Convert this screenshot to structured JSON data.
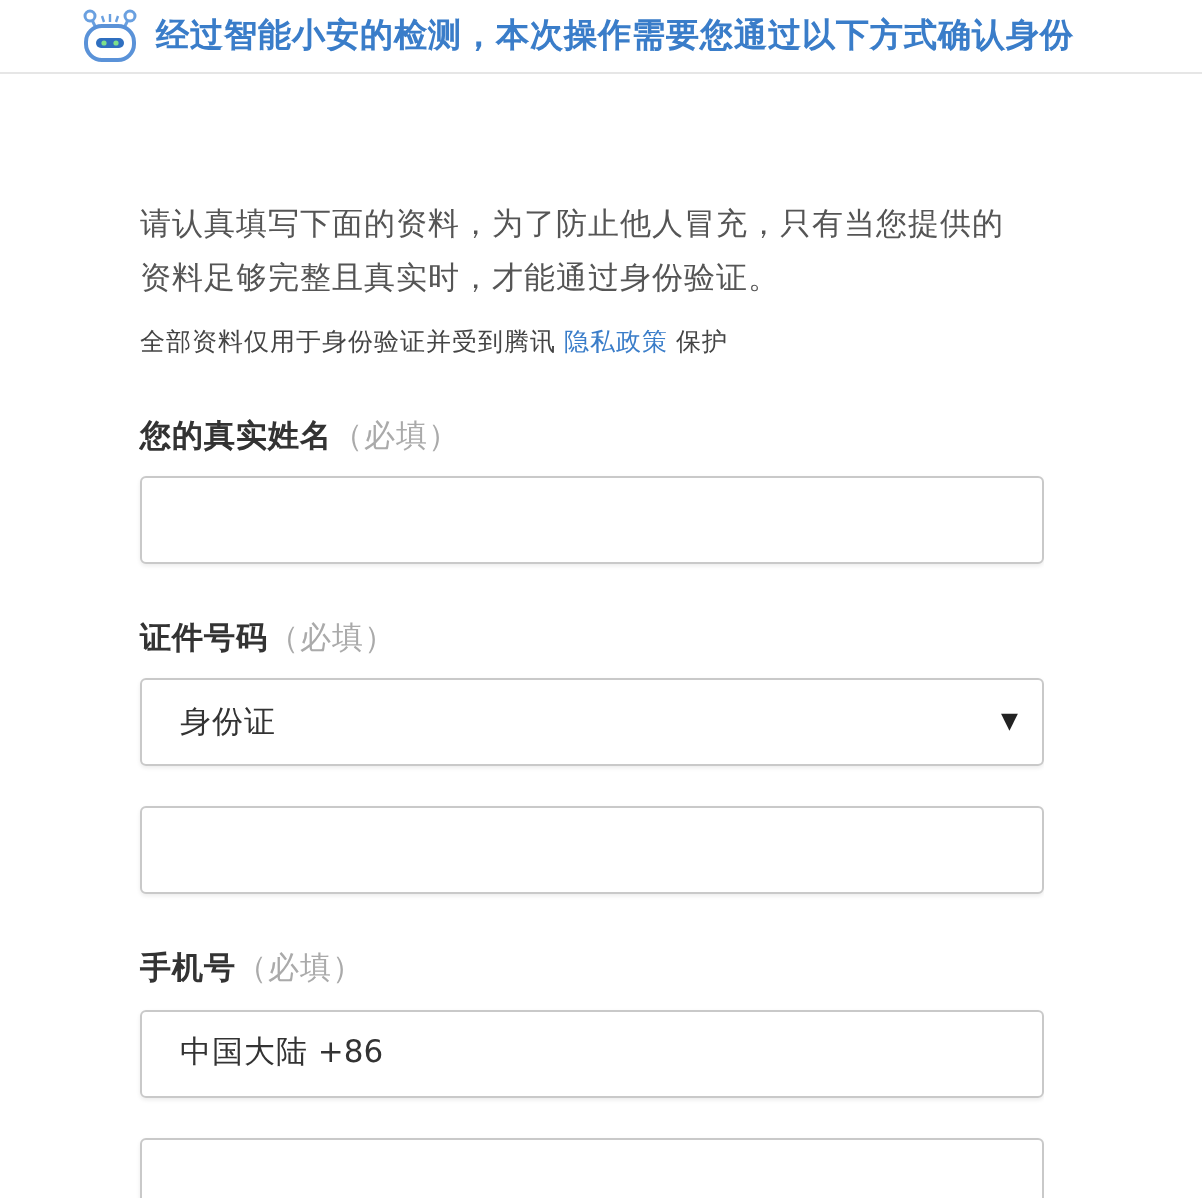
{
  "header": {
    "title": "经过智能小安的检测，本次操作需要您通过以下方式确认身份"
  },
  "intro": "请认真填写下面的资料，为了防止他人冒充，只有当您提供的资料足够完整且真实时，才能通过身份验证。",
  "note": {
    "before": "全部资料仅用于身份验证并受到腾讯",
    "link": "隐私政策",
    "after": "保护"
  },
  "sections": [
    {
      "label": "您的真实姓名",
      "hint": "（必填）",
      "fields": [
        {
          "kind": "text"
        }
      ]
    },
    {
      "label": "证件号码",
      "hint": "（必填）",
      "fields": [
        {
          "kind": "select",
          "value": "身份证",
          "arrow": "▼"
        },
        {
          "kind": "text"
        }
      ]
    },
    {
      "label": "手机号",
      "hint": "（必填）",
      "fields": [
        {
          "kind": "select",
          "value": "中国大陆 +86"
        },
        {
          "kind": "text"
        }
      ]
    }
  ]
}
